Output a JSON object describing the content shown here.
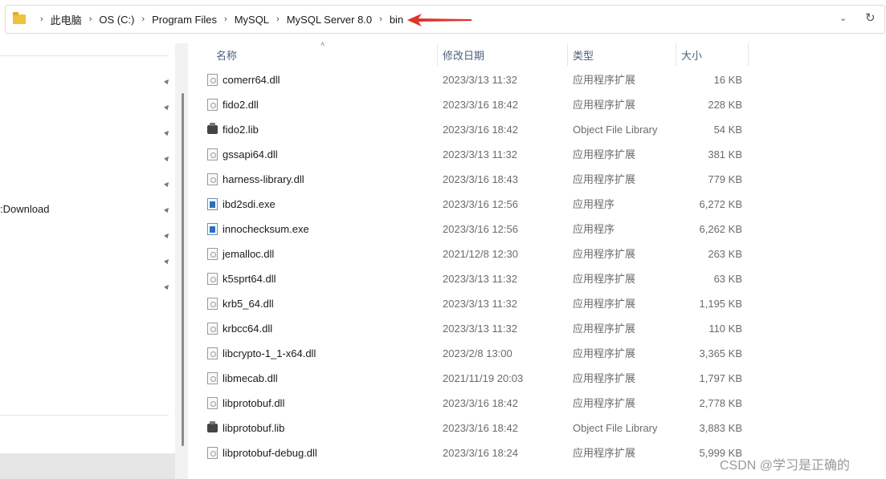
{
  "address_bar": {
    "crumbs": [
      "此电脑",
      "OS (C:)",
      "Program Files",
      "MySQL",
      "MySQL Server 8.0",
      "bin"
    ]
  },
  "left_pane": {
    "visible_label": ":Download"
  },
  "columns": {
    "name": "名称",
    "date": "修改日期",
    "type": "类型",
    "size": "大小"
  },
  "files": [
    {
      "name": "comerr64.dll",
      "date": "2023/3/13 11:32",
      "type": "应用程序扩展",
      "size": "16 KB",
      "icon": "dll-icon"
    },
    {
      "name": "fido2.dll",
      "date": "2023/3/16 18:42",
      "type": "应用程序扩展",
      "size": "228 KB",
      "icon": "dll-icon"
    },
    {
      "name": "fido2.lib",
      "date": "2023/3/16 18:42",
      "type": "Object File Library",
      "size": "54 KB",
      "icon": "lib-icon"
    },
    {
      "name": "gssapi64.dll",
      "date": "2023/3/13 11:32",
      "type": "应用程序扩展",
      "size": "381 KB",
      "icon": "dll-icon"
    },
    {
      "name": "harness-library.dll",
      "date": "2023/3/16 18:43",
      "type": "应用程序扩展",
      "size": "779 KB",
      "icon": "dll-icon"
    },
    {
      "name": "ibd2sdi.exe",
      "date": "2023/3/16 12:56",
      "type": "应用程序",
      "size": "6,272 KB",
      "icon": "exe-icon"
    },
    {
      "name": "innochecksum.exe",
      "date": "2023/3/16 12:56",
      "type": "应用程序",
      "size": "6,262 KB",
      "icon": "exe-icon"
    },
    {
      "name": "jemalloc.dll",
      "date": "2021/12/8 12:30",
      "type": "应用程序扩展",
      "size": "263 KB",
      "icon": "dll-icon"
    },
    {
      "name": "k5sprt64.dll",
      "date": "2023/3/13 11:32",
      "type": "应用程序扩展",
      "size": "63 KB",
      "icon": "dll-icon"
    },
    {
      "name": "krb5_64.dll",
      "date": "2023/3/13 11:32",
      "type": "应用程序扩展",
      "size": "1,195 KB",
      "icon": "dll-icon"
    },
    {
      "name": "krbcc64.dll",
      "date": "2023/3/13 11:32",
      "type": "应用程序扩展",
      "size": "110 KB",
      "icon": "dll-icon"
    },
    {
      "name": "libcrypto-1_1-x64.dll",
      "date": "2023/2/8 13:00",
      "type": "应用程序扩展",
      "size": "3,365 KB",
      "icon": "dll-icon"
    },
    {
      "name": "libmecab.dll",
      "date": "2021/11/19 20:03",
      "type": "应用程序扩展",
      "size": "1,797 KB",
      "icon": "dll-icon"
    },
    {
      "name": "libprotobuf.dll",
      "date": "2023/3/16 18:42",
      "type": "应用程序扩展",
      "size": "2,778 KB",
      "icon": "dll-icon"
    },
    {
      "name": "libprotobuf.lib",
      "date": "2023/3/16 18:42",
      "type": "Object File Library",
      "size": "3,883 KB",
      "icon": "lib-icon"
    },
    {
      "name": "libprotobuf-debug.dll",
      "date": "2023/3/16 18:24",
      "type": "应用程序扩展",
      "size": "5,999 KB",
      "icon": "dll-icon"
    }
  ],
  "watermark": "CSDN @学习是正确的",
  "colors": {
    "header_text": "#4c607a",
    "annotation_arrow": "#e0332d",
    "folder": "#f0c13d"
  }
}
